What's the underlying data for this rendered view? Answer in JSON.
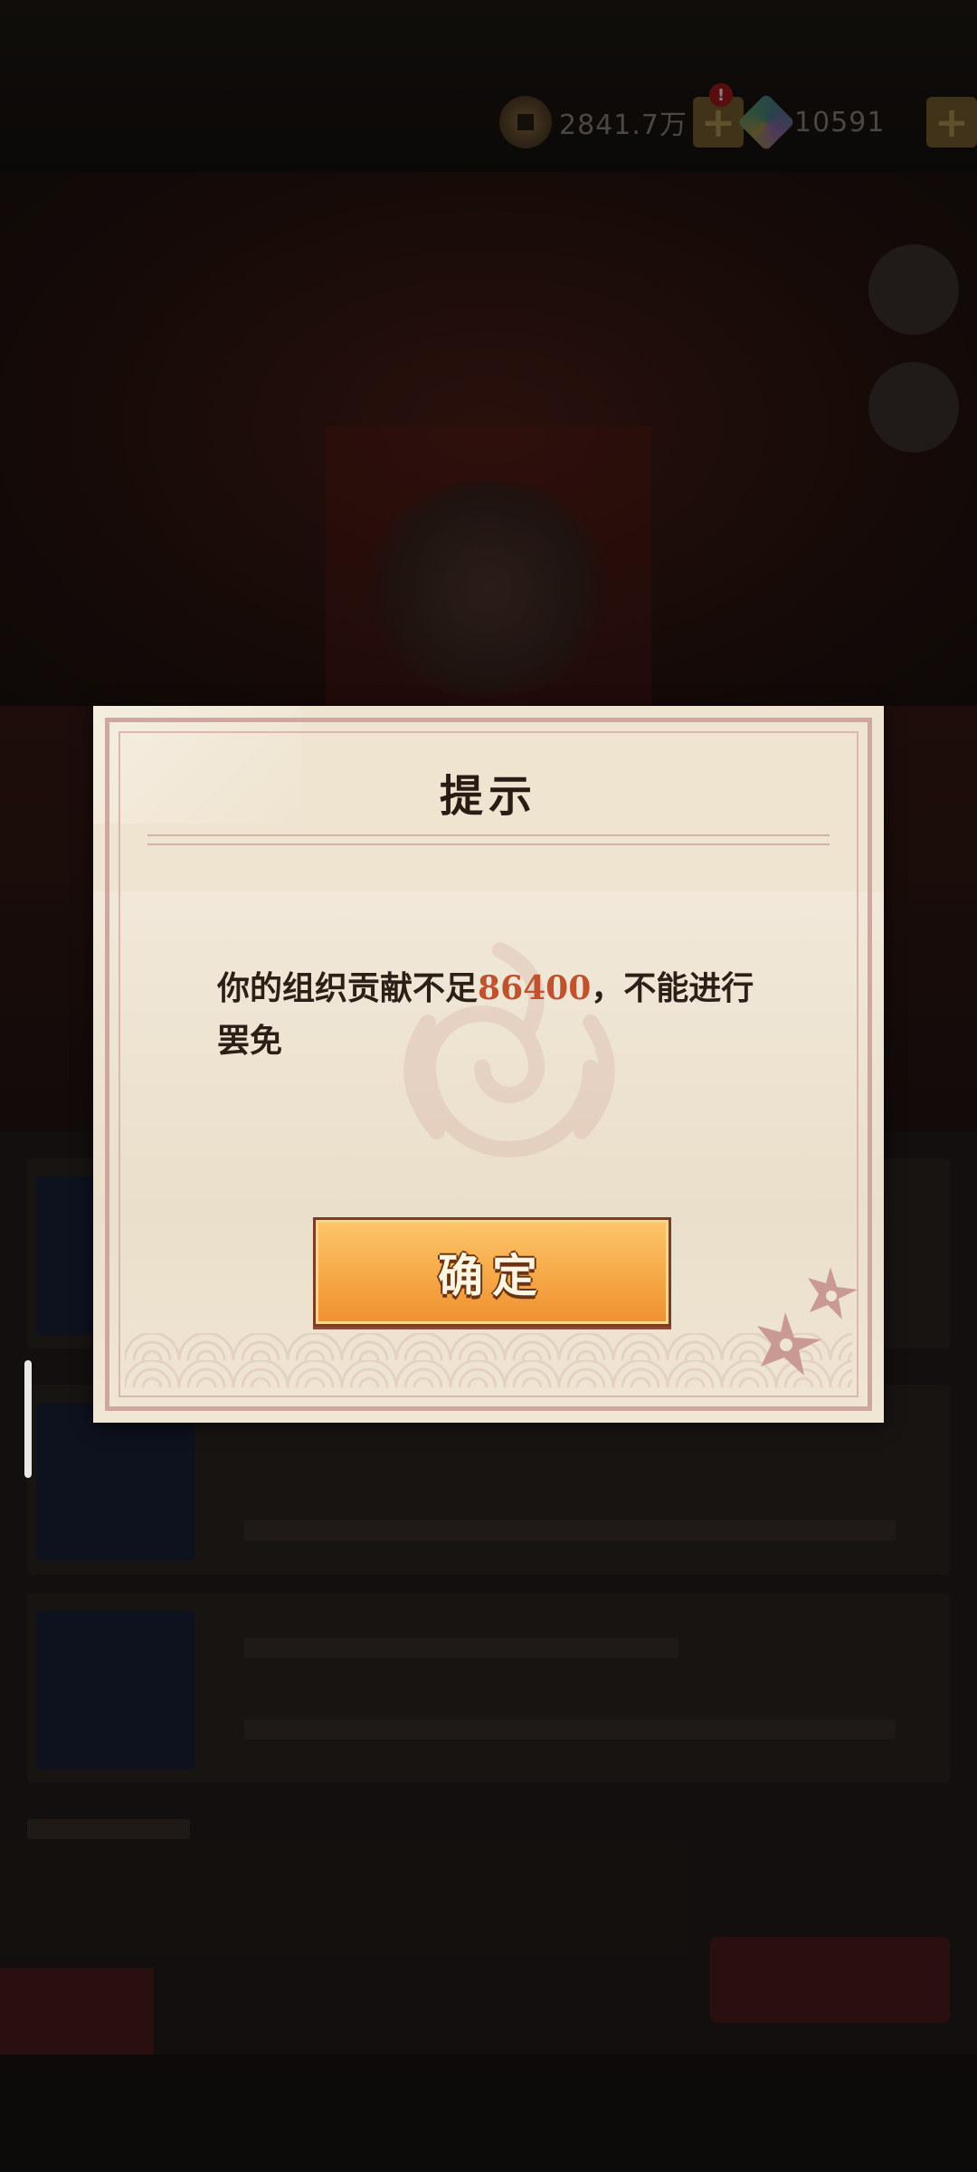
{
  "top_bar": {
    "coins": "2841.7万",
    "gems": "10591",
    "notice_badge": "!"
  },
  "dialog": {
    "title": "提示",
    "message_prefix": "你的组织贡献不足",
    "message_number": "86400",
    "message_suffix": "，不能进行罢免",
    "confirm_label": "确定"
  },
  "colors": {
    "highlight_number": "#c0532d",
    "button_orange": "#f6a847",
    "paper": "#efe4d0"
  }
}
